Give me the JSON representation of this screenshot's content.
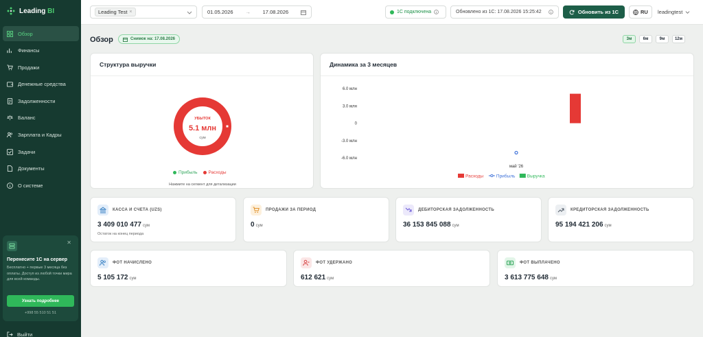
{
  "brand": {
    "name_main": "Leading",
    "name_accent": "BI"
  },
  "sidebar": {
    "items": [
      {
        "label": "Обзор",
        "icon": "grid-icon",
        "active": true
      },
      {
        "label": "Финансы",
        "icon": "bar-chart-icon"
      },
      {
        "label": "Продажи",
        "icon": "cart-icon"
      },
      {
        "label": "Денежные средства",
        "icon": "wallet-icon"
      },
      {
        "label": "Задолженности",
        "icon": "document-icon"
      },
      {
        "label": "Баланс",
        "icon": "scale-icon"
      },
      {
        "label": "Зарплата и Кадры",
        "icon": "users-icon"
      },
      {
        "label": "Задачи",
        "icon": "checkbox-icon"
      },
      {
        "label": "Документы",
        "icon": "file-icon"
      },
      {
        "label": "О системе",
        "icon": "info-icon"
      }
    ],
    "promo": {
      "title": "Перенесите 1С на сервер",
      "text": "Бесплатно + первые 3 месяца без оплаты. Доступ из любой точки мира для всей команды.",
      "button": "Узнать подробнее",
      "phone": "+998 55 510 51 51"
    },
    "logout": "Выйти"
  },
  "topbar": {
    "company": "Leading Test",
    "date_from": "01.05.2026",
    "date_to": "17.08.2026",
    "connection": "1С подключена",
    "updated": "Обновлено из 1С: 17.08.2026 15:25:42",
    "refresh": "Обновить из 1С",
    "language": "RU",
    "user": "leadingtest"
  },
  "page": {
    "title": "Обзор",
    "snapshot": "Снимок на: 17.08.2026",
    "periods": [
      {
        "label": "3м",
        "active": true
      },
      {
        "label": "6м"
      },
      {
        "label": "9м"
      },
      {
        "label": "12м"
      }
    ]
  },
  "revenue_structure": {
    "title": "Структура выручки",
    "center_label": "УБЫТОК",
    "center_value": "5.1 млн",
    "center_unit": "сум",
    "legend": [
      {
        "label": "Прибыль",
        "color": "#2fb85a"
      },
      {
        "label": "Расходы",
        "color": "#e53935"
      }
    ],
    "hint": "Нажмите на сегмент для детализации"
  },
  "dynamics": {
    "title": "Динамика за 3 месяцев"
  },
  "chart_data": [
    {
      "type": "pie",
      "title": "Структура выручки",
      "labels": [
        "Прибыль",
        "Расходы"
      ],
      "values": [
        0,
        5105172
      ],
      "colors": [
        "#2fb85a",
        "#e53935"
      ]
    },
    {
      "type": "bar",
      "title": "Динамика за 3 месяцев",
      "categories": [
        "май '26"
      ],
      "yticks": [
        "6.0 млн",
        "3.0 млн",
        "0",
        "-3.0 млн",
        "-6.0 млн"
      ],
      "ylim": [
        -6.0,
        6.0
      ],
      "yunit": "млн",
      "grid": false,
      "legend_position": "bottom",
      "series": [
        {
          "name": "Расходы",
          "kind": "bar",
          "color": "#e53935",
          "values": [
            5.1
          ]
        },
        {
          "name": "Прибыль",
          "kind": "line",
          "color": "#3b6fd8",
          "values": [
            -5.1
          ]
        },
        {
          "name": "Выручка",
          "kind": "bar",
          "color": "#2fb85a",
          "values": [
            0
          ]
        }
      ]
    }
  ],
  "kpis": [
    {
      "title": "КАССА И СЧЕТА (UZS)",
      "value": "3 409 010 477",
      "unit": "сум",
      "sub": "Остаток на конец периода",
      "icon": "bank-icon",
      "color": "#3b82c4",
      "bg": "#e3eefa"
    },
    {
      "title": "ПРОДАЖИ ЗА ПЕРИОД",
      "value": "0",
      "unit": "сум",
      "icon": "cart-icon",
      "color": "#e0902a",
      "bg": "#fdf0dc"
    },
    {
      "title": "ДЕБИТОРСКАЯ ЗАДОЛЖЕННОСТЬ",
      "value": "36 153 845 088",
      "unit": "сум",
      "icon": "trend-down-icon",
      "color": "#6b5bd6",
      "bg": "#ece9fb"
    },
    {
      "title": "КРЕДИТОРСКАЯ ЗАДОЛЖЕННОСТЬ",
      "value": "95 194 421 206",
      "unit": "сум",
      "icon": "trend-up-icon",
      "color": "#555f6a",
      "bg": "#eceff2"
    },
    {
      "title": "ФОТ НАЧИСЛЕНО",
      "value": "5 105 172",
      "unit": "сум",
      "icon": "users-icon",
      "color": "#3b82c4",
      "bg": "#e3eefa"
    },
    {
      "title": "ФОТ УДЕРЖАНО",
      "value": "612 621",
      "unit": "сум",
      "icon": "user-minus-icon",
      "color": "#d94a4a",
      "bg": "#fbe6e6"
    },
    {
      "title": "ФОТ ВЫПЛАЧЕНО",
      "value": "3 613 775 648",
      "unit": "сум",
      "icon": "cash-icon",
      "color": "#2fa55a",
      "bg": "#e2f5e8"
    }
  ]
}
